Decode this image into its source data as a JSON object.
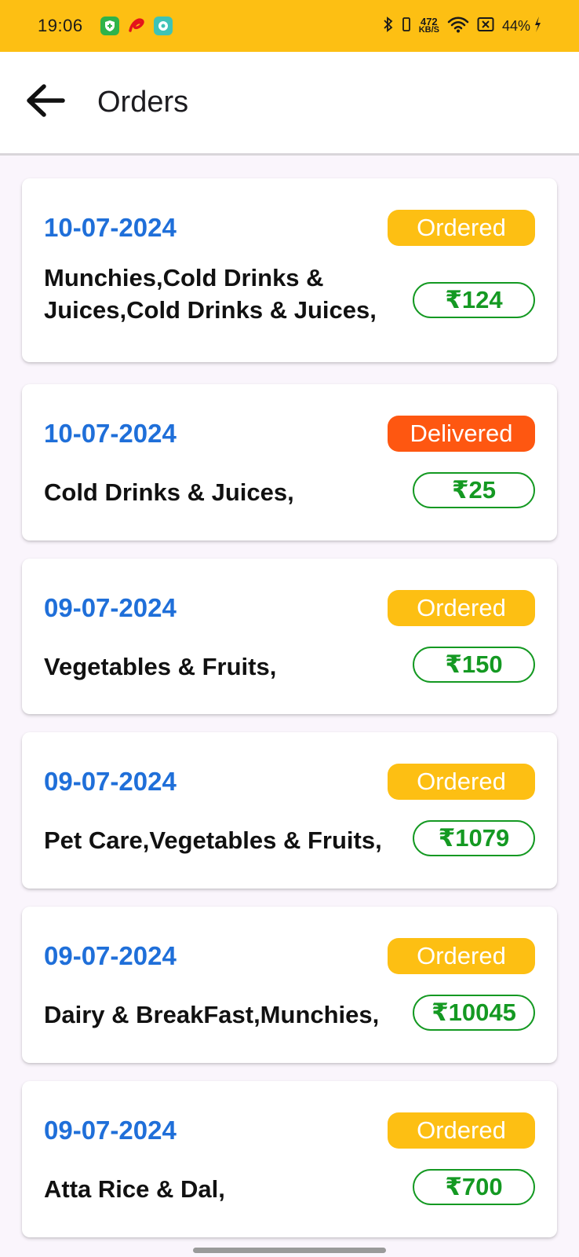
{
  "status_bar": {
    "time": "19:06",
    "net_speed_value": "472",
    "net_speed_unit": "KB/S",
    "battery": "44%",
    "icons": [
      "shield-app-icon",
      "airtel-app-icon",
      "chat-app-icon",
      "bluetooth-icon",
      "vibrate-icon",
      "wifi-icon",
      "sim-icon",
      "charging-icon"
    ]
  },
  "app_bar": {
    "back_icon": "arrow-left-icon",
    "title": "Orders"
  },
  "colors": {
    "status_bar": "#fdbf13",
    "date": "#1f6fd9",
    "ordered": "#fdbf13",
    "delivered": "#fe5711",
    "price": "#149922"
  },
  "orders": [
    {
      "date": "10-07-2024",
      "status": "Ordered",
      "status_type": "ordered",
      "items": "Munchies,Cold Drinks & Juices,Cold Drinks & Juices,",
      "price": "₹124"
    },
    {
      "date": "10-07-2024",
      "status": "Delivered",
      "status_type": "delivered",
      "items": "Cold Drinks & Juices,",
      "price": "₹25"
    },
    {
      "date": "09-07-2024",
      "status": "Ordered",
      "status_type": "ordered",
      "items": "Vegetables & Fruits,",
      "price": "₹150"
    },
    {
      "date": "09-07-2024",
      "status": "Ordered",
      "status_type": "ordered",
      "items": "Pet Care,Vegetables & Fruits,",
      "price": "₹1079"
    },
    {
      "date": "09-07-2024",
      "status": "Ordered",
      "status_type": "ordered",
      "items": "Dairy & BreakFast,Munchies,",
      "price": "₹10045"
    },
    {
      "date": "09-07-2024",
      "status": "Ordered",
      "status_type": "ordered",
      "items": "Atta Rice & Dal,",
      "price": "₹700"
    }
  ]
}
